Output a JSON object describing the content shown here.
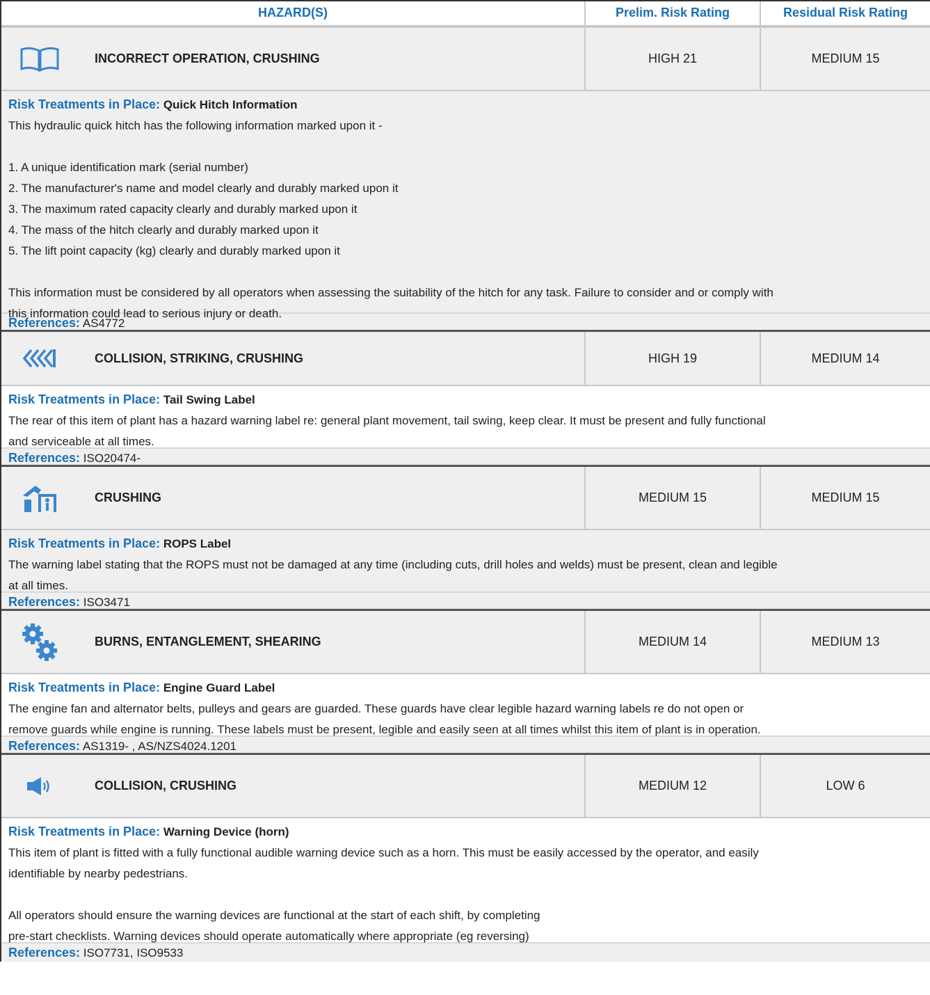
{
  "header": {
    "hazard": "HAZARD(S)",
    "prelim": "Prelim. Risk Rating",
    "residual": "Residual Risk Rating"
  },
  "labels": {
    "treatments": "Risk Treatments in Place:",
    "references": "References:"
  },
  "rows": [
    {
      "icon": "book-icon",
      "hazard": "INCORRECT OPERATION, CRUSHING",
      "prelim": "HIGH 21",
      "residual": "MEDIUM 15",
      "treatment_title": "Quick Hitch Information",
      "body": [
        "This hydraulic quick hitch has the following information marked upon it -",
        "",
        "1. A unique identification mark (serial number)",
        "2. The manufacturer's name and model clearly and durably marked upon it",
        "3. The maximum rated capacity clearly and durably marked upon it",
        "4. The mass of the hitch clearly and durably marked upon it",
        "5. The lift point capacity (kg) clearly and durably marked upon it",
        "",
        "This information must be considered by all operators when assessing the suitability of the hitch for any task. Failure to consider and or comply with",
        "this information could lead to serious injury or death."
      ],
      "references": "AS4772"
    },
    {
      "icon": "chevrons-left-icon",
      "hazard": "COLLISION, STRIKING, CRUSHING",
      "prelim": "HIGH 19",
      "residual": "MEDIUM 14",
      "treatment_title": "Tail Swing Label",
      "body": [
        "The rear of this item of plant has a hazard warning label re: general plant movement, tail swing, keep clear. It must be present and fully functional",
        "and serviceable at all times."
      ],
      "references": "ISO20474-"
    },
    {
      "icon": "rops-crush-icon",
      "hazard": "CRUSHING",
      "prelim": "MEDIUM 15",
      "residual": "MEDIUM 15",
      "treatment_title": "ROPS Label",
      "body": [
        "The warning label stating that the ROPS must not be damaged at any time (including cuts, drill holes and welds) must be present, clean and legible",
        "at all times."
      ],
      "references": "ISO3471"
    },
    {
      "icon": "gears-icon",
      "hazard": "BURNS, ENTANGLEMENT, SHEARING",
      "prelim": "MEDIUM 14",
      "residual": "MEDIUM 13",
      "treatment_title": "Engine Guard Label",
      "body": [
        "The engine fan and alternator belts, pulleys and gears are guarded. These guards have clear legible hazard warning labels re do not open or",
        "remove guards while engine is running. These labels must be present, legible and easily seen at all times whilst this item of plant is in operation."
      ],
      "references": "AS1319- , AS/NZS4024.1201"
    },
    {
      "icon": "speaker-icon",
      "hazard": "COLLISION, CRUSHING",
      "prelim": "MEDIUM 12",
      "residual": "LOW 6",
      "treatment_title": "Warning Device (horn)",
      "body": [
        "This item of plant is fitted with a fully functional audible warning device such as a horn. This must be easily accessed by the operator, and easily",
        "identifiable by nearby pedestrians.",
        "",
        "All operators should ensure the warning devices are functional at the start of each shift, by completing",
        "pre-start checklists. Warning devices should operate automatically where appropriate (eg reversing)"
      ],
      "references": "ISO7731, ISO9533"
    }
  ],
  "colors": {
    "accent": "#1a6fb5",
    "icon": "#3a86cf",
    "row_bg": "#efefef"
  }
}
